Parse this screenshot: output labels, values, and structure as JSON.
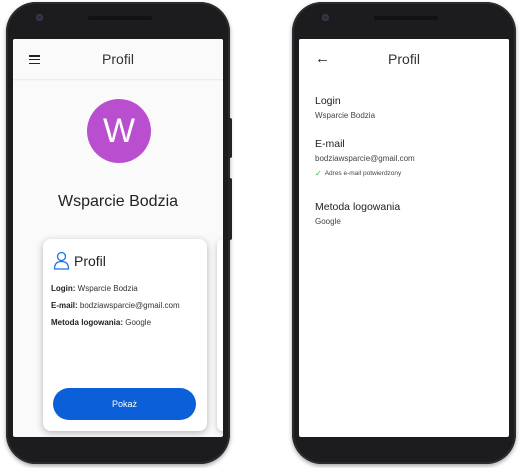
{
  "left_phone": {
    "appbar": {
      "title": "Profil",
      "menu_icon": "menu-icon"
    },
    "avatar": {
      "letter": "W",
      "color": "#b94fcf"
    },
    "username": "Wsparcie Bodzia",
    "card": {
      "title": "Profil",
      "icon": "person-icon",
      "login_label": "Login:",
      "login_value": "Wsparcie Bodzia",
      "email_label": "E-mail:",
      "email_value": "bodziawsparcie@gmail.com",
      "method_label": "Metoda logowania:",
      "method_value": "Google",
      "button_label": "Pokaż"
    }
  },
  "right_phone": {
    "appbar": {
      "title": "Profil",
      "back_icon": "back-arrow-icon"
    },
    "login": {
      "label": "Login",
      "value": "Wsparcie Bodzia"
    },
    "email": {
      "label": "E-mail",
      "value": "bodziawsparcie@gmail.com",
      "verified": "Adres e-mail potwierdzony"
    },
    "method": {
      "label": "Metoda logowania",
      "value": "Google"
    }
  },
  "colors": {
    "accent": "#0b5fd8",
    "avatar": "#b94fcf",
    "verified": "#3cb043"
  }
}
